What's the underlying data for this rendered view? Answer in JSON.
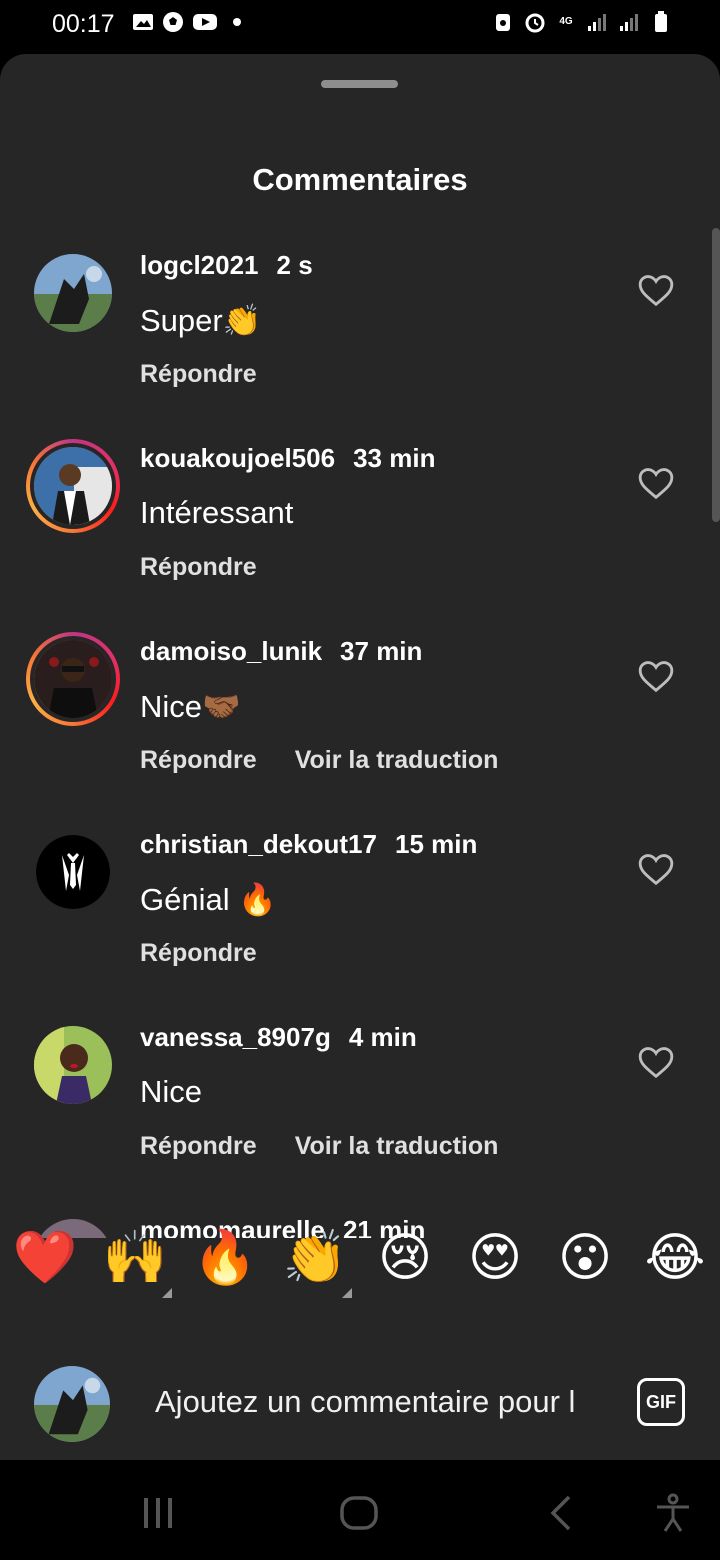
{
  "status_bar": {
    "time": "00:17",
    "network": "4G"
  },
  "sheet": {
    "title": "Commentaires"
  },
  "comments": [
    {
      "username": "logcl2021",
      "time": "2 s",
      "text": "Super👏",
      "reply": "Répondre",
      "translate": ""
    },
    {
      "username": "kouakoujoel506",
      "time": "33 min",
      "text": "Intéressant",
      "reply": "Répondre",
      "translate": ""
    },
    {
      "username": "damoiso_lunik",
      "time": "37 min",
      "text": "Nice🤝🏾",
      "reply": "Répondre",
      "translate": "Voir la traduction"
    },
    {
      "username": "christian_dekout17",
      "time": "15 min",
      "text": "Génial 🔥",
      "reply": "Répondre",
      "translate": ""
    },
    {
      "username": "vanessa_8907g",
      "time": "4 min",
      "text": "Nice",
      "reply": "Répondre",
      "translate": "Voir la traduction"
    },
    {
      "username": "momomaurelle",
      "time": "21 min",
      "text": "",
      "reply": "",
      "translate": ""
    }
  ],
  "emoji_bar": [
    "❤️",
    "🙌",
    "🔥",
    "👏",
    "😢",
    "😍",
    "😮",
    "😂"
  ],
  "composer": {
    "placeholder": "Ajoutez un commentaire pour l",
    "gif_label": "GIF"
  },
  "colors": {
    "background": "#262626",
    "ring": "#e1306c",
    "text": "#ffffff"
  }
}
